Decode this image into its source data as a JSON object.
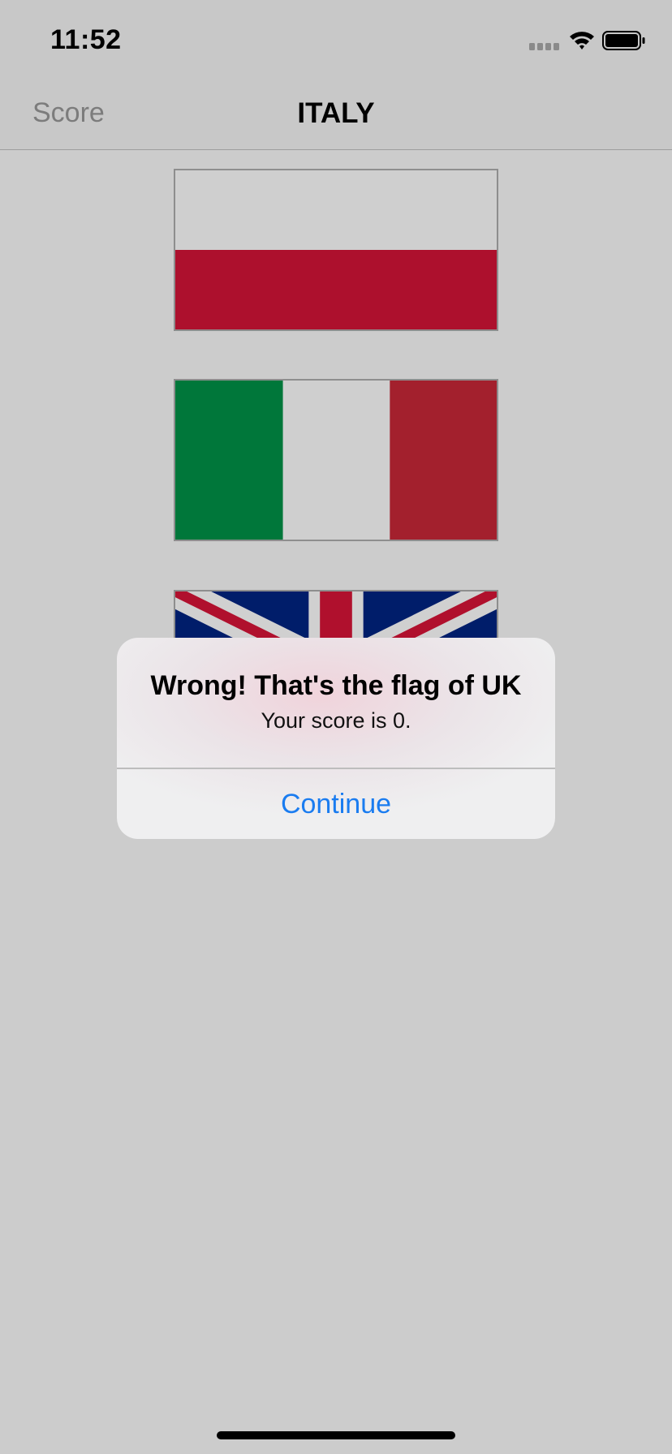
{
  "status_bar": {
    "time": "11:52",
    "icons": [
      "cellular-signal-icon",
      "wifi-icon",
      "battery-icon"
    ]
  },
  "nav_bar": {
    "left_item": "Score",
    "title": "ITALY"
  },
  "flags": [
    {
      "country": "Poland",
      "icon": "poland-flag"
    },
    {
      "country": "Italy",
      "icon": "italy-flag"
    },
    {
      "country": "UK",
      "icon": "uk-flag"
    }
  ],
  "alert": {
    "title": "Wrong! That's the flag of UK",
    "message": "Your score is 0.",
    "button": "Continue"
  },
  "colors": {
    "background": "#cccccc",
    "accent": "#1a7cf0",
    "poland_red": "#ad102d",
    "italy_green": "#00773a",
    "italy_red": "#a3202d",
    "uk_blue": "#001d6a",
    "uk_red": "#b0102d"
  }
}
